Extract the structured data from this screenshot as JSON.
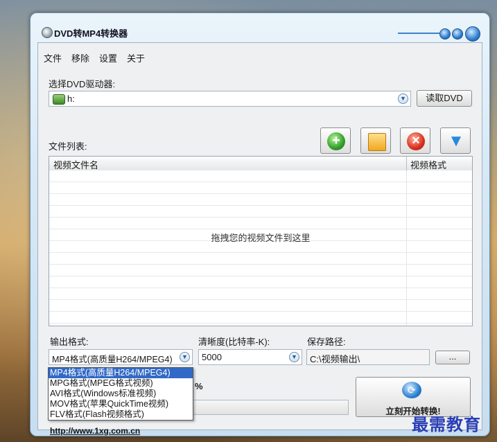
{
  "window": {
    "title": "DVD转MP4转换器"
  },
  "menu": {
    "items": [
      "文件",
      "移除",
      "设置",
      "关于"
    ]
  },
  "dvd": {
    "label": "选择DVD驱动器:",
    "selected_drive": "h:",
    "read_button": "读取DVD"
  },
  "file_list": {
    "label": "文件列表:",
    "columns": {
      "name": "视频文件名",
      "format": "视频格式"
    },
    "drop_hint": "拖拽您的视频文件到这里"
  },
  "toolbar": {
    "icons": [
      "add-icon",
      "folder-icon",
      "remove-icon",
      "filter-icon"
    ],
    "add_glyph": "+",
    "remove_glyph": "×",
    "filter_glyph": "▼"
  },
  "output": {
    "format_label": "输出格式:",
    "format_selected": "MP4格式(高质量H264/MPEG4)",
    "format_options": [
      "MP4格式(高质量H264/MPEG4)",
      "MPG格式(MPEG格式视频)",
      "AVI格式(Windows标准视频)",
      "MOV格式(苹果QuickTime视频)",
      "FLV格式(Flash视频格式)"
    ],
    "bitrate_label": "清晰度(比特率-K):",
    "bitrate_value": "5000",
    "path_label": "保存路径:",
    "path_value": "C:\\视频输出\\",
    "browse_button": "..."
  },
  "progress": {
    "percent_text": "%",
    "value": 0
  },
  "start_button": {
    "label": "立刻开始转换!"
  },
  "footer": {
    "link": "http://www.1xg.com.cn"
  },
  "watermark": "最需教育"
}
